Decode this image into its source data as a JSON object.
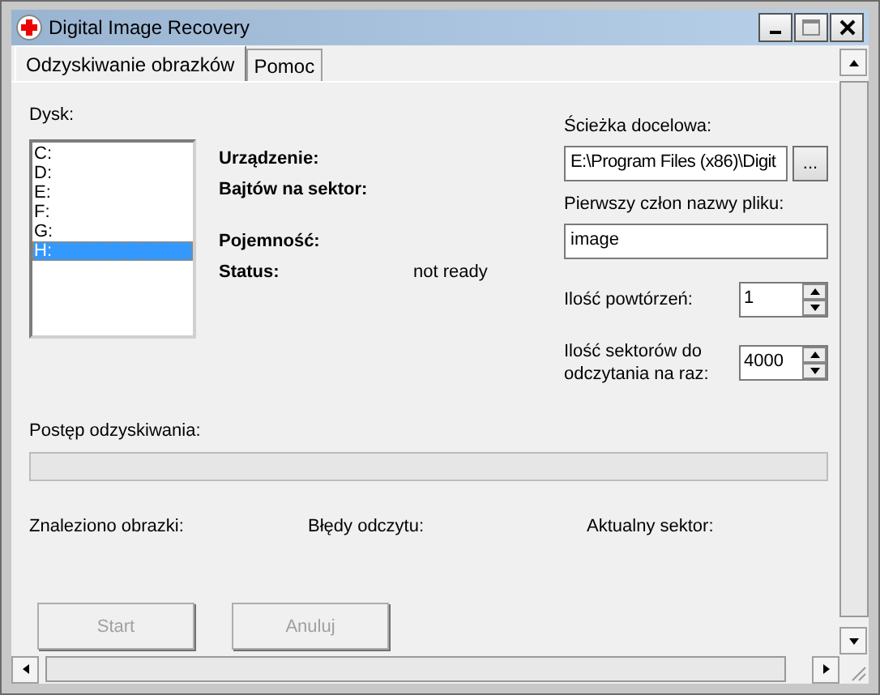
{
  "window": {
    "title": "Digital Image Recovery"
  },
  "tabs": [
    {
      "label": "Odzyskiwanie obrazków",
      "selected": true
    },
    {
      "label": "Pomoc",
      "selected": false
    }
  ],
  "disk": {
    "label": "Dysk:",
    "items": [
      {
        "label": "C:",
        "selected": false
      },
      {
        "label": "D:",
        "selected": false
      },
      {
        "label": "E:",
        "selected": false
      },
      {
        "label": "F:",
        "selected": false
      },
      {
        "label": "G:",
        "selected": false
      },
      {
        "label": "H:",
        "selected": true
      }
    ]
  },
  "info": [
    {
      "label": "Urządzenie:"
    },
    {
      "label": "Bajtów na sektor:"
    },
    {
      "label": "Pojemność:"
    },
    {
      "label": "Status:",
      "value": "not ready"
    }
  ],
  "destination": {
    "label": "Ścieżka docelowa:",
    "value": "E:\\Program Files (x86)\\Digit",
    "browse": "..."
  },
  "prefix": {
    "label": "Pierwszy człon nazwy pliku:",
    "value": "image"
  },
  "spinners": [
    {
      "label": "Ilość powtórzeń:",
      "value": "1"
    },
    {
      "label": "Ilość sektorów do odczytania na raz:",
      "value": "4000"
    }
  ],
  "progress": {
    "label": "Postęp odzyskiwania:",
    "level": 0
  },
  "stats": [
    "Znaleziono obrazki:",
    "Błędy odczytu:",
    "Aktualny sektor:"
  ],
  "buttons": [
    {
      "label": "Start",
      "disabled": true
    },
    {
      "label": "Anuluj",
      "disabled": true
    }
  ]
}
